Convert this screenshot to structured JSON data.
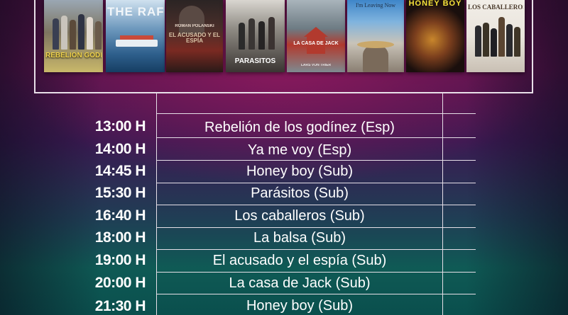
{
  "posters": [
    {
      "id": "rebelion",
      "title": "REBELIÓN GODÍNEZ",
      "sub": "",
      "color": "#f0d24a"
    },
    {
      "id": "the-raft",
      "title": "THE RAFT",
      "sub": "",
      "color": "#ffffff"
    },
    {
      "id": "el-acusado",
      "title": "EL ACUSADO Y EL ESPÍA",
      "sub": "ROMAN POLANSKI",
      "color": "#e8d7c9"
    },
    {
      "id": "parasitos",
      "title": "PARÁSITOS",
      "sub": "",
      "color": "#ffffff"
    },
    {
      "id": "casa-jack",
      "title": "LA CASA DE JACK",
      "sub": "LARS VON TRIER",
      "color": "#ffffff"
    },
    {
      "id": "leaving-now",
      "title": "I'm Leaving Now",
      "sub": "",
      "color": "#1e2e44"
    },
    {
      "id": "honey-boy",
      "title": "HONEY BOY",
      "sub": "",
      "color": "#f5e23a"
    },
    {
      "id": "caballeros",
      "title": "LOS CABALLEROS",
      "sub": "",
      "color": "#4a3a2c"
    }
  ],
  "schedule": [
    {
      "time": "13:00 H",
      "title": "Rebelión de los godínez (Esp)"
    },
    {
      "time": "14:00 H",
      "title": "Ya me voy (Esp)"
    },
    {
      "time": "14:45 H",
      "title": "Honey boy (Sub)"
    },
    {
      "time": "15:30 H",
      "title": "Parásitos (Sub)"
    },
    {
      "time": "16:40 H",
      "title": "Los caballeros (Sub)"
    },
    {
      "time": "18:00 H",
      "title": "La balsa (Sub)"
    },
    {
      "time": "19:00 H",
      "title": "El acusado y el espía (Sub)"
    },
    {
      "time": "20:00 H",
      "title": "La casa de Jack (Sub)"
    },
    {
      "time": "21:30 H",
      "title": "Honey boy (Sub)"
    }
  ]
}
